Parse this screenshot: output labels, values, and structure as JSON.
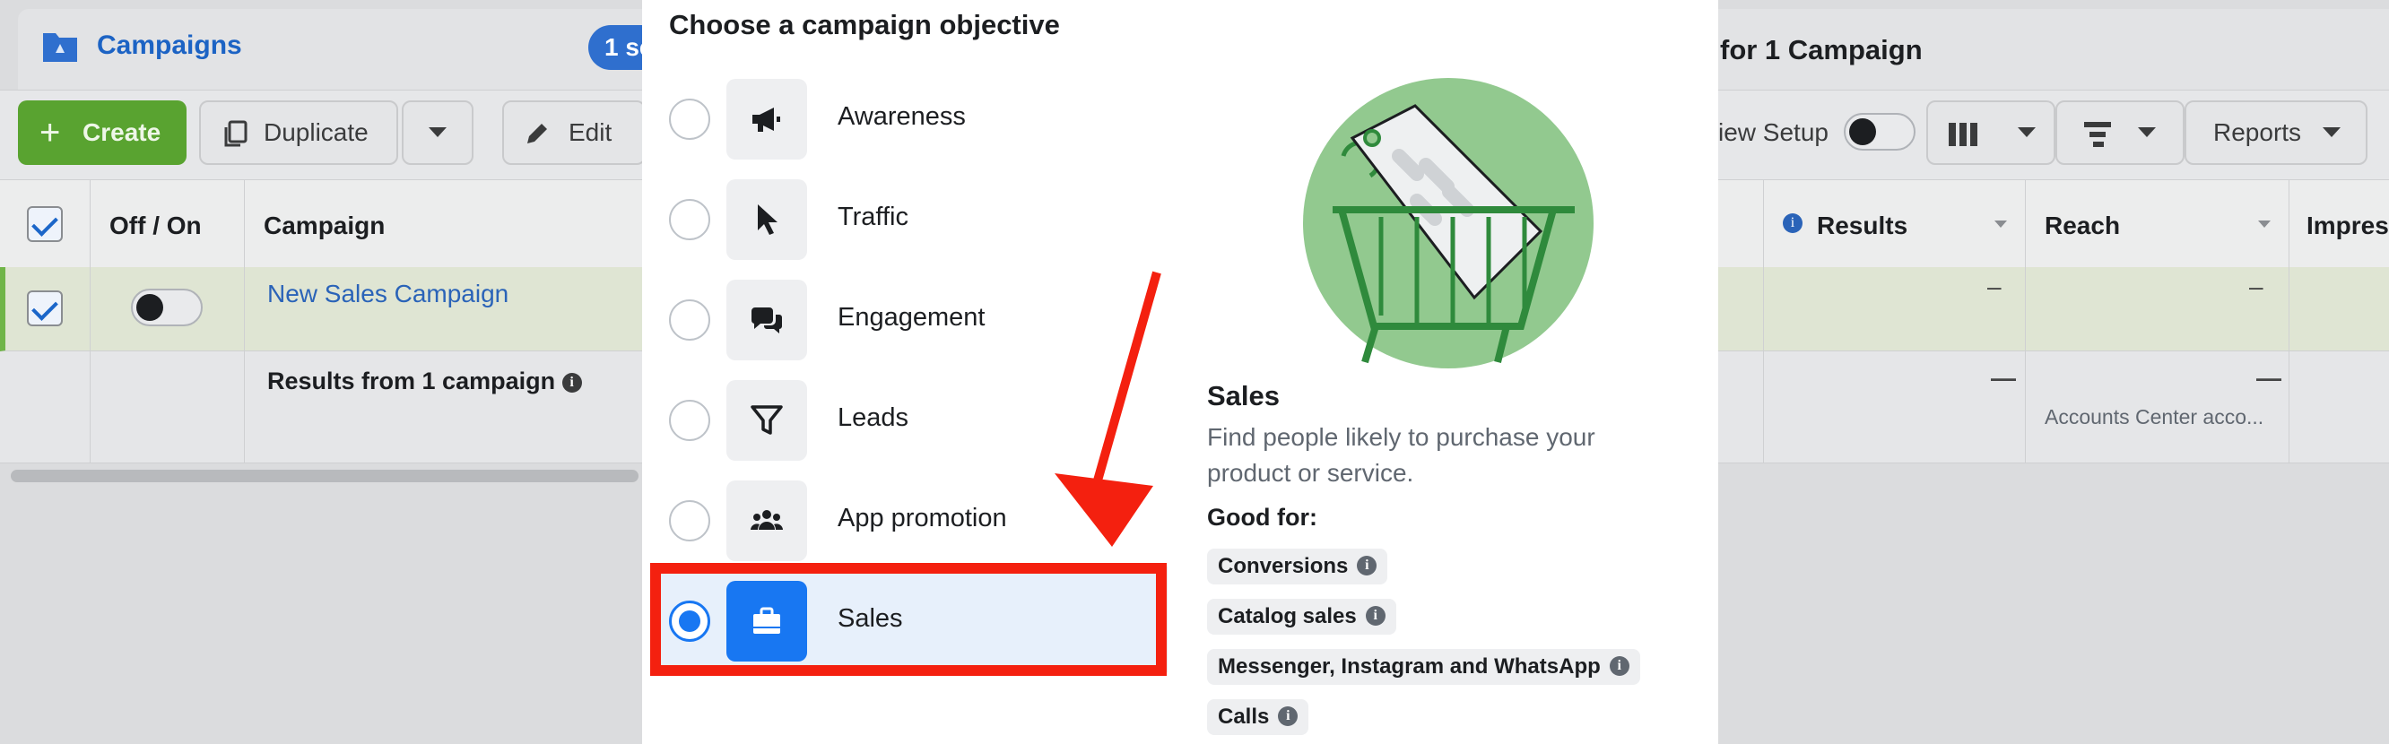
{
  "background": {
    "section_title": "Campaigns",
    "selected_pill": "1 se",
    "edit_title": "for 1 Campaign",
    "toolbar": {
      "create": "Create",
      "duplicate": "Duplicate",
      "edit": "Edit",
      "view_setup": "iew Setup",
      "reports": "Reports"
    },
    "columns": {
      "off_on": "Off / On",
      "campaign": "Campaign",
      "results": "Results",
      "reach": "Reach",
      "impressions": "Impres"
    },
    "rows": [
      {
        "campaign": "New Sales Campaign",
        "results": "–",
        "reach": "–"
      }
    ],
    "summary": {
      "label": "Results from 1 campaign",
      "results": "—",
      "reach": "—",
      "reach_note": "Accounts Center acco..."
    }
  },
  "modal": {
    "title": "Choose a campaign objective",
    "objectives": [
      {
        "label": "Awareness",
        "icon": "megaphone-icon",
        "selected": false
      },
      {
        "label": "Traffic",
        "icon": "cursor-icon",
        "selected": false
      },
      {
        "label": "Engagement",
        "icon": "chat-bubbles-icon",
        "selected": false
      },
      {
        "label": "Leads",
        "icon": "funnel-icon",
        "selected": false
      },
      {
        "label": "App promotion",
        "icon": "people-icon",
        "selected": false
      },
      {
        "label": "Sales",
        "icon": "shopping-bag-icon",
        "selected": true
      }
    ],
    "detail": {
      "title": "Sales",
      "description_line1": "Find people likely to purchase your",
      "description_line2": "product or service.",
      "good_for_label": "Good for:",
      "tags": [
        "Conversions",
        "Catalog sales",
        "Messenger, Instagram and WhatsApp",
        "Calls"
      ]
    }
  },
  "colors": {
    "accent": "#1877f2",
    "annotation": "#f4200f",
    "create_green": "#59a330"
  }
}
